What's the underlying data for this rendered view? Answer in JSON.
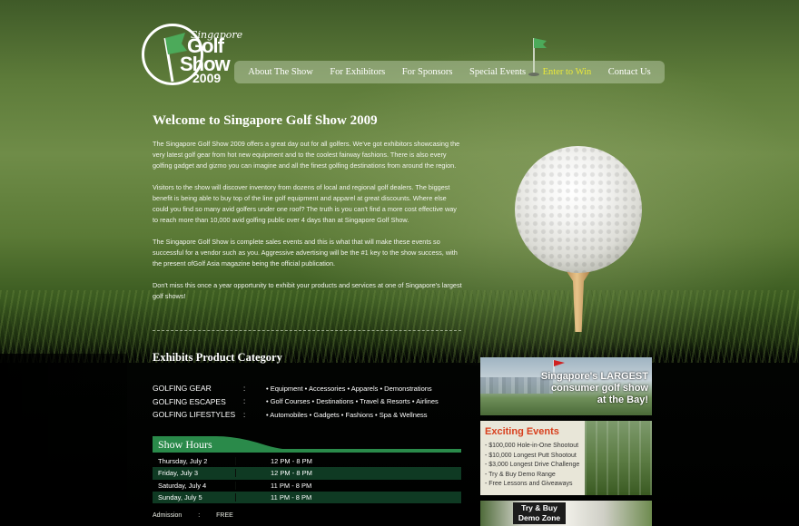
{
  "logo": {
    "small": "Singapore",
    "word1": "Golf",
    "word2": "Show",
    "year": "2009"
  },
  "nav": {
    "items": [
      {
        "label": "About The Show"
      },
      {
        "label": "For Exhibitors"
      },
      {
        "label": "For Sponsors"
      },
      {
        "label": "Special Events"
      },
      {
        "label": "Enter to Win"
      },
      {
        "label": "Contact Us"
      }
    ],
    "highlight_color": "#e9e83a"
  },
  "main": {
    "title": "Welcome to Singapore Golf Show 2009",
    "paragraphs": [
      "The Singapore Golf Show 2009 offers a great day out for all golfers. We've got exhibitors showcasing the very latest golf gear from hot new equipment and to the coolest fairway fashions. There is also every golfing gadget and gizmo you can imagine and all the finest golfing destinations from around the region.",
      "Visitors to the show will discover inventory from dozens of local and regional golf dealers. The biggest benefit is being able to buy top of the line golf equipment and apparel at great discounts. Where else could you find so many avid golfers under one roof? The truth is you can't find a more cost effective way to reach more than 10,000 avid golfing public over 4 days than at Singapore Golf Show.",
      "The Singapore Golf Show is complete sales events and this is what that will make these events so successful for a vendor such as you. Aggressive advertising will be the #1 key to the show success, with the present ofGolf Asia magazine being the official publication.",
      "Don't miss this once a year opportunity to exhibit your products and services at one of Singapore's largest golf shows!"
    ]
  },
  "exhibits": {
    "title": "Exhibits Product Category",
    "rows": [
      {
        "name": "GOLFING GEAR",
        "colon": ":",
        "items": "• Equipment   • Accessories   • Apparels   • Demonstrations"
      },
      {
        "name": "GOLFING ESCAPES",
        "colon": ":",
        "items": "• Golf Courses   • Destinations   • Travel & Resorts   • Airlines"
      },
      {
        "name": "GOLFING LIFESTYLES",
        "colon": ":",
        "items": "• Automobiles   • Gadgets   • Fashions   • Spa & Wellness"
      }
    ]
  },
  "hours": {
    "title": "Show Hours",
    "rows": [
      {
        "day": "Thursday, July 2",
        "time": "12 PM - 8 PM"
      },
      {
        "day": "Friday, July 3",
        "time": "12 PM - 8 PM"
      },
      {
        "day": "Saturday, July 4",
        "time": "11 PM - 8 PM"
      },
      {
        "day": "Sunday, July 5",
        "time": "11 PM - 8 PM"
      }
    ],
    "admission_label": "Admission",
    "admission_colon": ":",
    "admission_value": "FREE",
    "accent_color": "#2a8a4a"
  },
  "ads": {
    "ad1": {
      "line1": "Singapore's LARGEST",
      "line2": "consumer golf show",
      "line3": "at the Bay!"
    },
    "ad2": {
      "title": "Exciting Events",
      "items": [
        "- $100,000 Hole-in-One Shootout",
        "- $10,000 Longest Putt Shootout",
        "- $3,000 Longest Drive Challenge",
        "- Try & Buy Demo Range",
        "- Free Lessons and Giveaways"
      ],
      "title_color": "#d8401e"
    },
    "ad3": {
      "line1": "Try & Buy",
      "line2": "Demo Zone"
    }
  }
}
